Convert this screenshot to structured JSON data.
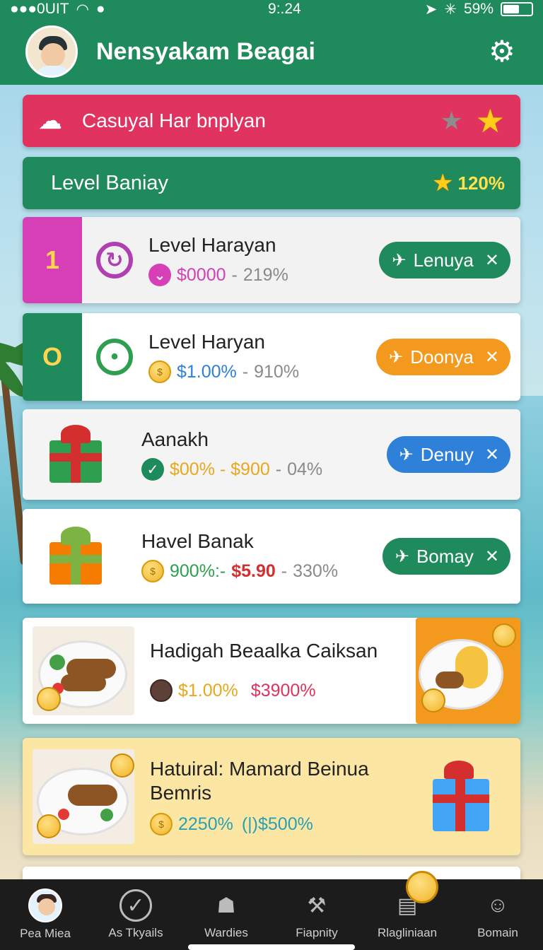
{
  "status_bar": {
    "carrier": "●●●0UIT",
    "time": "9:.24",
    "battery_percent": "59%",
    "battery_level": 0.59
  },
  "header": {
    "title": "Nensyakam Beagai",
    "settings_icon": "gear-icon"
  },
  "banners": {
    "red": {
      "label": "Casuyal Har bnplyan",
      "color": "#e0335f"
    },
    "green": {
      "label": "Level Baniay",
      "percent": "120%",
      "color": "#1f8a5b"
    }
  },
  "cards": [
    {
      "tab": "1",
      "title": "Level Harayan",
      "stat1": "$0000",
      "dash": "-",
      "stat2": "219%",
      "button": "Lenuya",
      "button_color": "#1f8a5b",
      "accent": "#d63fb5"
    },
    {
      "tab": "O",
      "title": "Level Haryan",
      "stat1": "$1.00%",
      "dash": "-",
      "stat2": "910%",
      "button": "Doonya",
      "button_color": "#f39a1e",
      "accent": "#1f8a5b"
    },
    {
      "title": "Aanakh",
      "stat1": "$00% - $900",
      "dash": "-",
      "stat2": "04%",
      "button": "Denuy",
      "button_color": "#2f80d8"
    },
    {
      "title": "Havel Banak",
      "stat1": "900%:-",
      "stat2": "$5.90",
      "dash": "-",
      "stat3": "330%",
      "button": "Bomay",
      "button_color": "#1f8a5b"
    },
    {
      "title": "Hadigah Beaalka Caiksan",
      "stat1": "$1.00%",
      "stat2": "$3900%"
    },
    {
      "title_line1": "Hatuiral: Mamard Beinua",
      "title_line2": "Bemris",
      "stat1": "2250%",
      "stat2": "(|)$500%"
    }
  ],
  "bottom_nav": [
    {
      "label": "Pea Miea",
      "icon": "avatar-icon"
    },
    {
      "label": "As Tkyails",
      "icon": "search-check-icon"
    },
    {
      "label": "Wardies",
      "icon": "cart-icon"
    },
    {
      "label": "Fiapnity",
      "icon": "tools-icon"
    },
    {
      "label": "Rlagliniaan",
      "icon": "wallet-icon"
    },
    {
      "label": "Bomain",
      "icon": "profile-icon"
    }
  ]
}
